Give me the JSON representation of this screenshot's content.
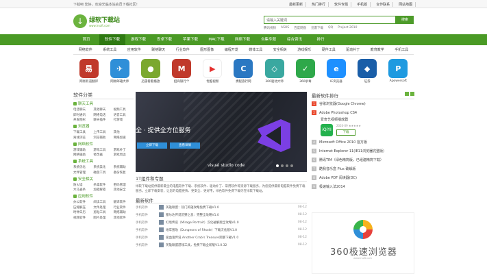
{
  "topbar": {
    "welcome": "下载吧 您好，欢迎光临本站会员下载社区！",
    "links": [
      "最新更新",
      "热门排行",
      "软件专题",
      "手机版",
      "合作联系",
      "网站地图"
    ]
  },
  "logo": {
    "name": "绿软下载站",
    "url": "www.lrsoft.com"
  },
  "search": {
    "value": "请输入关键词",
    "button": "搜索",
    "hot": [
      "腾讯视频",
      "ASUS",
      "百度网盘",
      "迅雷下载",
      "QQ",
      "Project 2010"
    ]
  },
  "nav": [
    "首页",
    "软件下载",
    "游戏下载",
    "安卓下载",
    "苹果下载",
    "MAC下载",
    "网络下载",
    "合集专题",
    "综合资讯",
    "排行"
  ],
  "subnav": [
    "网络软件",
    "系统工具",
    "应用软件",
    "联络聊天",
    "行业软件",
    "图形图像",
    "编程开发",
    "媒体工具",
    "安全相关",
    "游戏娱乐",
    "硬件工具",
    "驱动补丁",
    "教育教学",
    "手机工具"
  ],
  "apps": [
    {
      "label": "网易有道翻译",
      "color": "#c0392b",
      "glyph": "易"
    },
    {
      "label": "网易邮箱大师",
      "color": "#2f8fd8",
      "glyph": "✈"
    },
    {
      "label": "迅雷看看播放",
      "color": "#7ba82f",
      "glyph": "●"
    },
    {
      "label": "招商银行个",
      "color": "#c0392b",
      "glyph": "M"
    },
    {
      "label": "优酷视频",
      "color": "#ffffff",
      "glyph": "▶"
    },
    {
      "label": "携程旅行网",
      "color": "#2b78c2",
      "glyph": "C"
    },
    {
      "label": "360驱动大师",
      "color": "#3aa8a0",
      "glyph": "◇"
    },
    {
      "label": "360杀毒",
      "color": "#2ea84a",
      "glyph": "✓"
    },
    {
      "label": "IE浏览器",
      "color": "#1e90ff",
      "glyph": "e"
    },
    {
      "label": "证券",
      "color": "#1a5ea8",
      "glyph": "◆"
    },
    {
      "label": "Apowersoft",
      "color": "#1f9ae0",
      "glyph": "P"
    }
  ],
  "left": {
    "title": "软件分类",
    "sections": [
      {
        "name": "聊天工具",
        "items": [
          "电话聊天",
          "其他聊天",
          "视频工具",
          "即时通讯",
          "网络电话",
          "语音工具",
          "开发图形",
          "聊天插件",
          "打游戏"
        ]
      },
      {
        "name": "浏览器",
        "items": [
          "下载工具",
          "上传工具",
          "其他",
          "离线浏览",
          "浏览辅助",
          "网络加速"
        ]
      },
      {
        "name": "网络软件",
        "items": [
          "游戏辅助",
          "游戏工具",
          "游戏补丁",
          "网络辅助",
          "修改器",
          "游戏周边"
        ]
      },
      {
        "name": "系统工具",
        "items": [
          "系统优化",
          "系统美化",
          "系统辅助",
          "文件管理",
          "磁盘工具",
          "备份恢复"
        ]
      },
      {
        "name": "安全相关",
        "items": [
          "防火墙",
          "杀毒软件",
          "密码管理",
          "木马查杀",
          "加密解密",
          "其他安全"
        ]
      },
      {
        "name": "应用软件",
        "items": [
          "办公软件",
          "阅读工具",
          "翻译软件",
          "压缩解压",
          "文件处理",
          "行业软件",
          "时钟日历",
          "剪贴工具",
          "网络辅助",
          "视频软件",
          "图片处理",
          "其他软件"
        ]
      }
    ]
  },
  "banner": {
    "title": "全 · 提供全方位服务",
    "btn1": "立即下载",
    "btn2": "查看详情",
    "product": "visual studio code"
  },
  "topic": {
    "title": "1T组件和专题",
    "text": "绿软下载站提供最新最全的电脑软件下载、系统软件、驱动补丁、常用软件等资源下载服务，为您提供最新电脑软件免费下载服务。立即下载安装，让您的电脑更快、更安全、更好用，绿色软件免费下载尽在绿软下载站。"
  },
  "latest": {
    "title": "最新软件",
    "rows": [
      {
        "cat": "手机软件",
        "name": "英雄联盟：热门英雄攻略免费下载V1.0",
        "date": "08-12"
      },
      {
        "cat": "手机软件",
        "name": "塞尔达传说荒野之息：完整全攻略V1.0",
        "date": "08-12"
      },
      {
        "cat": "手机软件",
        "name": "幻境传说（Mirage Portrait）汉化破解版全攻略V1.0",
        "date": "08-12"
      },
      {
        "cat": "手机软件",
        "name": "地牢围攻（Dungeons of Rhode）下载汉化版V1.0",
        "date": "08-12"
      },
      {
        "cat": "手机软件",
        "name": "吸血鬼传说 Another Crab's Treasure完整下载V1.0",
        "date": "08-12"
      },
      {
        "cat": "手机软件",
        "name": "英雄联盟游戏工具，免费下载全新版V1.0.32",
        "date": "08-12"
      }
    ]
  },
  "right": {
    "title": "最新软件排行",
    "top": [
      {
        "n": "1",
        "name": "谷歌浏览器(Google Chrome)"
      },
      {
        "n": "2",
        "name": "Adobe Photoshop CS4"
      }
    ],
    "featured": {
      "name": "爱奇艺视频播放器",
      "meta": "2020-09 ★★★★★",
      "download": "下载",
      "icon": "iQIYI"
    },
    "rest": [
      {
        "n": "4",
        "name": "Microsoft Office 2010 官方版"
      },
      {
        "n": "5",
        "name": "Internet Explorer 11(IE11浏览器完整版)"
      },
      {
        "n": "6",
        "name": "腾讯TIM（绿色精简版，已组建精简下载）"
      },
      {
        "n": "7",
        "name": "酷我音乐盒 Plus 破解版"
      },
      {
        "n": "8",
        "name": "Adobe PDF 阅读器(DC)"
      },
      {
        "n": "9",
        "name": "极速输入法2014"
      }
    ]
  },
  "ad": {
    "text": "360极速浏览器",
    "url": "www.lrsoft.com"
  }
}
